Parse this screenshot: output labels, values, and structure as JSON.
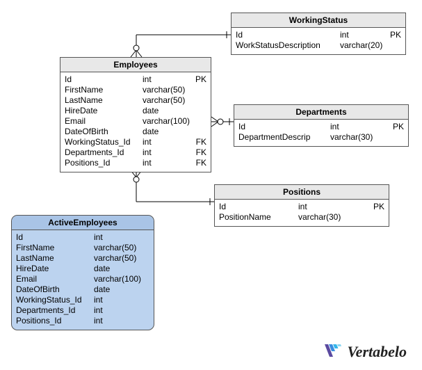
{
  "watermark": "Vertabelo",
  "entities": {
    "employees": {
      "title": "Employees",
      "columns": [
        {
          "name": "Id",
          "type": "int",
          "key": "PK"
        },
        {
          "name": "FirstName",
          "type": "varchar(50)",
          "key": ""
        },
        {
          "name": "LastName",
          "type": "varchar(50)",
          "key": ""
        },
        {
          "name": "HireDate",
          "type": "date",
          "key": ""
        },
        {
          "name": "Email",
          "type": "varchar(100)",
          "key": ""
        },
        {
          "name": "DateOfBirth",
          "type": "date",
          "key": ""
        },
        {
          "name": "WorkingStatus_Id",
          "type": "int",
          "key": "FK"
        },
        {
          "name": "Departments_Id",
          "type": "int",
          "key": "FK"
        },
        {
          "name": "Positions_Id",
          "type": "int",
          "key": "FK"
        }
      ]
    },
    "working_status": {
      "title": "WorkingStatus",
      "columns": [
        {
          "name": "Id",
          "type": "int",
          "key": "PK"
        },
        {
          "name": "WorkStatusDescription",
          "type": "varchar(20)",
          "key": ""
        }
      ]
    },
    "departments": {
      "title": "Departments",
      "columns": [
        {
          "name": "Id",
          "type": "int",
          "key": "PK"
        },
        {
          "name": "DepartmentDescrip",
          "type": "varchar(30)",
          "key": ""
        }
      ]
    },
    "positions": {
      "title": "Positions",
      "columns": [
        {
          "name": "Id",
          "type": "int",
          "key": "PK"
        },
        {
          "name": "PositionName",
          "type": "varchar(30)",
          "key": ""
        }
      ]
    },
    "active_employees": {
      "title": "ActiveEmployees",
      "columns": [
        {
          "name": "Id",
          "type": "int",
          "key": ""
        },
        {
          "name": "FirstName",
          "type": "varchar(50)",
          "key": ""
        },
        {
          "name": "LastName",
          "type": "varchar(50)",
          "key": ""
        },
        {
          "name": "HireDate",
          "type": "date",
          "key": ""
        },
        {
          "name": "Email",
          "type": "varchar(100)",
          "key": ""
        },
        {
          "name": "DateOfBirth",
          "type": "date",
          "key": ""
        },
        {
          "name": "WorkingStatus_Id",
          "type": "int",
          "key": ""
        },
        {
          "name": "Departments_Id",
          "type": "int",
          "key": ""
        },
        {
          "name": "Positions_Id",
          "type": "int",
          "key": ""
        }
      ]
    }
  },
  "chart_data": {
    "type": "diagram",
    "diagram_kind": "ER",
    "tables": [
      "Employees",
      "WorkingStatus",
      "Departments",
      "Positions",
      "ActiveEmployees"
    ],
    "relationships": [
      {
        "from": "Employees",
        "from_card": "many-optional",
        "to": "WorkingStatus",
        "to_card": "one"
      },
      {
        "from": "Employees",
        "from_card": "many-optional",
        "to": "Departments",
        "to_card": "one"
      },
      {
        "from": "Employees",
        "from_card": "many-optional",
        "to": "Positions",
        "to_card": "one"
      }
    ]
  }
}
